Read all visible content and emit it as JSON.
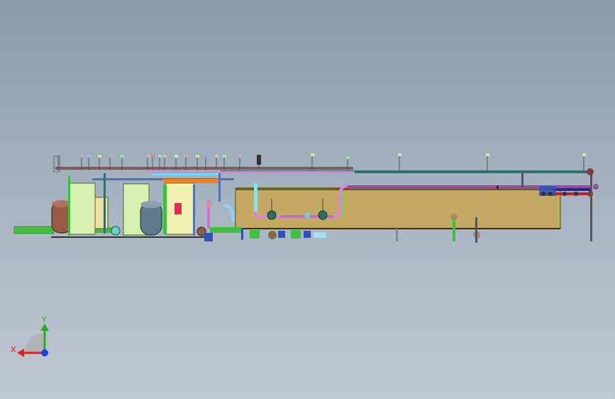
{
  "viewport": {
    "background_top": "#8a9aab",
    "background_bottom": "#bfc8d2"
  },
  "triad": {
    "x_label": "X",
    "y_label": "Y",
    "x_color": "#e02020",
    "y_color": "#20b020",
    "z_color": "#2040e0"
  },
  "colors": {
    "tank_body": "#c4a963",
    "pipe_green": "#3fbf3f",
    "pipe_pink": "#d070d0",
    "pipe_orange": "#f08020",
    "pipe_cyan": "#70e0e0",
    "pipe_teal": "#2f7f7f",
    "pipe_purple": "#8a3a8a",
    "vessel_copper": "#9a5a4a",
    "vessel_steel": "#5f7a8a",
    "panel_light": "#d8f0b0"
  }
}
